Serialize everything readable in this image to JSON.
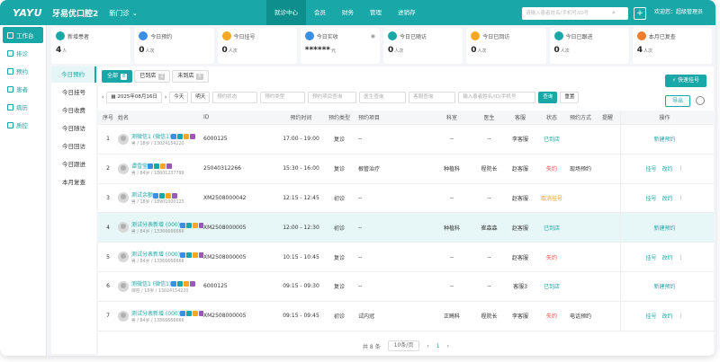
{
  "header": {
    "logo": "YAYU",
    "clinic": "牙易优口腔2",
    "store": "新门诊",
    "nav": [
      "就诊中心",
      "会员",
      "财务",
      "管理",
      "进销存"
    ],
    "search_placeholder": "请输入患者姓名/手机号/ID号",
    "plus": "+",
    "welcome": "欢迎您：超级管理员"
  },
  "sidebar": {
    "items": [
      {
        "label": "工作台",
        "icon": "dashboard-icon"
      },
      {
        "label": "排诊",
        "icon": "schedule-icon"
      },
      {
        "label": "预约",
        "icon": "calendar-icon"
      },
      {
        "label": "患者",
        "icon": "patient-icon"
      },
      {
        "label": "病历",
        "icon": "record-icon"
      },
      {
        "label": "质控",
        "icon": "quality-icon"
      }
    ]
  },
  "cards": [
    {
      "label": "新增患者",
      "value": "4",
      "unit": "人",
      "color": "#1aa7a7"
    },
    {
      "label": "今日预约",
      "value": "0",
      "unit": "人次",
      "color": "#3a8ee6"
    },
    {
      "label": "今日挂号",
      "value": "0",
      "unit": "人次",
      "color": "#f5a623"
    },
    {
      "label": "今日实收",
      "value": "******",
      "unit": "元",
      "color": "#3a8ee6"
    },
    {
      "label": "今日已随访",
      "value": "0",
      "unit": "人次",
      "color": "#1aa7a7"
    },
    {
      "label": "今日已回访",
      "value": "0",
      "unit": "人次",
      "color": "#f5a623"
    },
    {
      "label": "今日已跟进",
      "value": "0",
      "unit": "人次",
      "color": "#1aa7a7"
    },
    {
      "label": "本月已复查",
      "value": "4",
      "unit": "人次",
      "color": "#f07c2e"
    }
  ],
  "subnav": [
    "今日预约",
    "今日挂号",
    "今日收费",
    "今日随访",
    "今日回访",
    "今日跟进",
    "本月复查"
  ],
  "tabs": [
    {
      "label": "全部",
      "count": "8"
    },
    {
      "label": "已到店",
      "count": "2"
    },
    {
      "label": "未到店",
      "count": "6"
    }
  ],
  "quick_btn": "快速挂号",
  "filters": {
    "date": "2025年08月16日",
    "today": "今天",
    "tomorrow": "明天",
    "status": "预约状态",
    "type": "预约类型",
    "item": "预约项目查询",
    "doctor": "医生查询",
    "service": "客服查询",
    "keyword": "输入患者姓名/ID/手机号",
    "search": "查询",
    "reset": "重置",
    "export": "导出"
  },
  "columns": [
    "序号",
    "姓名",
    "ID",
    "预约时间",
    "预约类型",
    "预约项目",
    "科室",
    "医生",
    "客服",
    "状态",
    "预约方式",
    "提醒",
    "操作"
  ],
  "rows": [
    {
      "no": "1",
      "name": "测微信1 (微信1)",
      "meta": "男 / 18岁 / 13024154220",
      "id": "6000125",
      "time": "17:00 - 19:00",
      "type": "复诊",
      "item": "--",
      "dept": "--",
      "doc": "--",
      "serv": "李客服",
      "status": "已到店",
      "status_cls": "st-done",
      "way": "",
      "ops": [
        "新建预约"
      ]
    },
    {
      "no": "2",
      "name": "谭雪莹",
      "meta": "男 / 84岁 / 18601237799",
      "id": "25040312266",
      "time": "15:30 - 16:00",
      "type": "复诊",
      "item": "根管治疗",
      "dept": "种植科",
      "doc": "程院长",
      "serv": "赵客服",
      "status": "失约",
      "status_cls": "st-miss",
      "way": "现场预约",
      "ops": [
        "挂号",
        "改约",
        "⋮"
      ]
    },
    {
      "no": "3",
      "name": "测试余额",
      "meta": "男 / 18岁 / 18901000123",
      "id": "XM2508000042",
      "time": "12:15 - 12:45",
      "type": "初诊",
      "item": "--",
      "dept": "--",
      "doc": "--",
      "serv": "赵客服",
      "status": "取消挂号",
      "status_cls": "st-cancel",
      "way": "",
      "ops": [
        "挂号",
        "改约",
        "⋮"
      ]
    },
    {
      "no": "4",
      "name": "测试分表新增 (000)",
      "meta": "男 / 84岁 / 13366666666",
      "id": "XM2508000005",
      "time": "12:00 - 12:30",
      "type": "初诊",
      "item": "--",
      "dept": "种植科",
      "doc": "崔森森",
      "serv": "赵客服",
      "status": "已到店",
      "status_cls": "st-done",
      "way": "",
      "ops": [
        "新建预约"
      ]
    },
    {
      "no": "5",
      "name": "测试分表新增 (000)",
      "meta": "男 / 84岁 / 13366666666",
      "id": "XM2508000005",
      "time": "10:15 - 10:45",
      "type": "复诊",
      "item": "--",
      "dept": "--",
      "doc": "--",
      "serv": "赵客服",
      "status": "失约",
      "status_cls": "st-miss",
      "way": "",
      "ops": [
        "挂号",
        "改约",
        "⋮"
      ]
    },
    {
      "no": "6",
      "name": "测微信1 (微信1)",
      "meta": "保密 / 18岁 / 13024154220",
      "id": "6000125",
      "time": "09:15 - 09:30",
      "type": "复诊",
      "item": "--",
      "dept": "--",
      "doc": "--",
      "serv": "客服3",
      "status": "已到店",
      "status_cls": "st-done",
      "way": "",
      "ops": [
        "新建预约"
      ]
    },
    {
      "no": "7",
      "name": "测试分表新增 (000)",
      "meta": "男 / 84岁 / 13366666666",
      "id": "XM2508000005",
      "time": "09:15 - 09:45",
      "type": "初诊",
      "item": "试内冠",
      "dept": "正畸科",
      "doc": "程院长",
      "serv": "李客服",
      "status": "失约",
      "status_cls": "st-miss",
      "way": "电话预约",
      "ops": [
        "挂号",
        "改约",
        "⋮"
      ]
    }
  ],
  "pager": {
    "total": "共 8 条",
    "size": "10条/页",
    "prev": "‹",
    "page": "1",
    "next": "›"
  }
}
